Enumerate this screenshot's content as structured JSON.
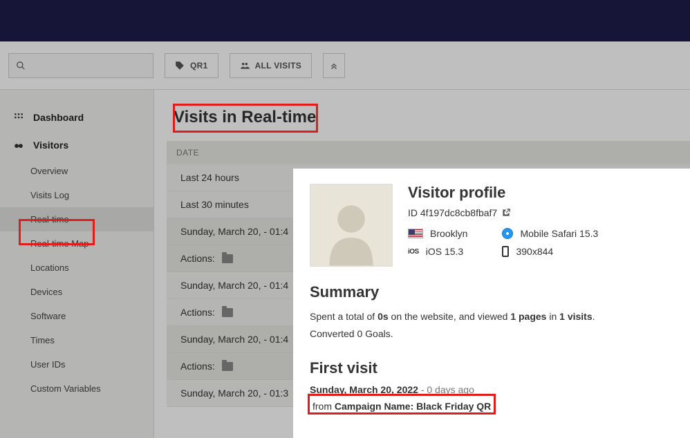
{
  "toolbar": {
    "qr_button": "QR1",
    "all_visits": "ALL VISITS"
  },
  "sidebar": {
    "dashboard": "Dashboard",
    "visitors": "Visitors",
    "items": [
      "Overview",
      "Visits Log",
      "Real-time",
      "Real-time Map",
      "Locations",
      "Devices",
      "Software",
      "Times",
      "User IDs",
      "Custom Variables"
    ]
  },
  "content": {
    "title": "Visits in Real-time",
    "date_header": "DATE",
    "rows": {
      "r0": "Last 24 hours",
      "r1": "Last 30 minutes",
      "r2": "Sunday, March 20, - 01:4",
      "r3": "Actions:",
      "r4": "Sunday, March 20, - 01:4",
      "r5": "Actions:",
      "r6": "Sunday, March 20, - 01:4",
      "r7": "Actions:",
      "r8": "Sunday, March 20, - 01:3"
    }
  },
  "popup": {
    "title": "Visitor profile",
    "id_label": "ID 4f197dc8cb8fbaf7",
    "location": "Brooklyn",
    "browser": "Mobile Safari 15.3",
    "os": "iOS 15.3",
    "resolution": "390x844",
    "summary_heading": "Summary",
    "summary_p1_a": "Spent a total of ",
    "summary_time": "0s",
    "summary_p1_b": " on the website, and viewed ",
    "summary_pages": "1 pages",
    "summary_in": " in ",
    "summary_visits": "1 visits",
    "summary_period": ".",
    "summary_p2": "Converted 0 Goals.",
    "firstvisit_heading": "First visit",
    "firstvisit_date": "Sunday, March 20, 2022",
    "firstvisit_ago": " - 0 days ago",
    "campaign_from": "from ",
    "campaign_name": "Campaign Name: Black Friday QR"
  }
}
